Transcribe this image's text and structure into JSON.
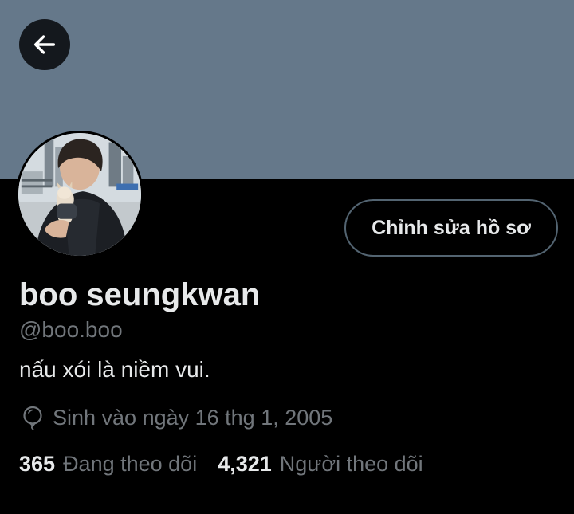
{
  "profile": {
    "display_name": "boo seungkwan",
    "handle": "@boo.boo",
    "bio": "nấu xói là niềm vui.",
    "birth_date": "Sinh vào ngày 16 thg 1, 2005"
  },
  "actions": {
    "edit_profile_label": "Chỉnh sửa hồ sơ"
  },
  "stats": {
    "following_count": "365",
    "following_label": "Đang theo dõi",
    "followers_count": "4,321",
    "followers_label": "Người theo dõi"
  },
  "icons": {
    "back": "arrow-left-icon",
    "birthday": "balloon-icon"
  },
  "colors": {
    "banner": "#65788a",
    "background": "#000000",
    "primary_text": "#e7e9ea",
    "secondary_text": "#71767b",
    "button_border": "#536471"
  }
}
